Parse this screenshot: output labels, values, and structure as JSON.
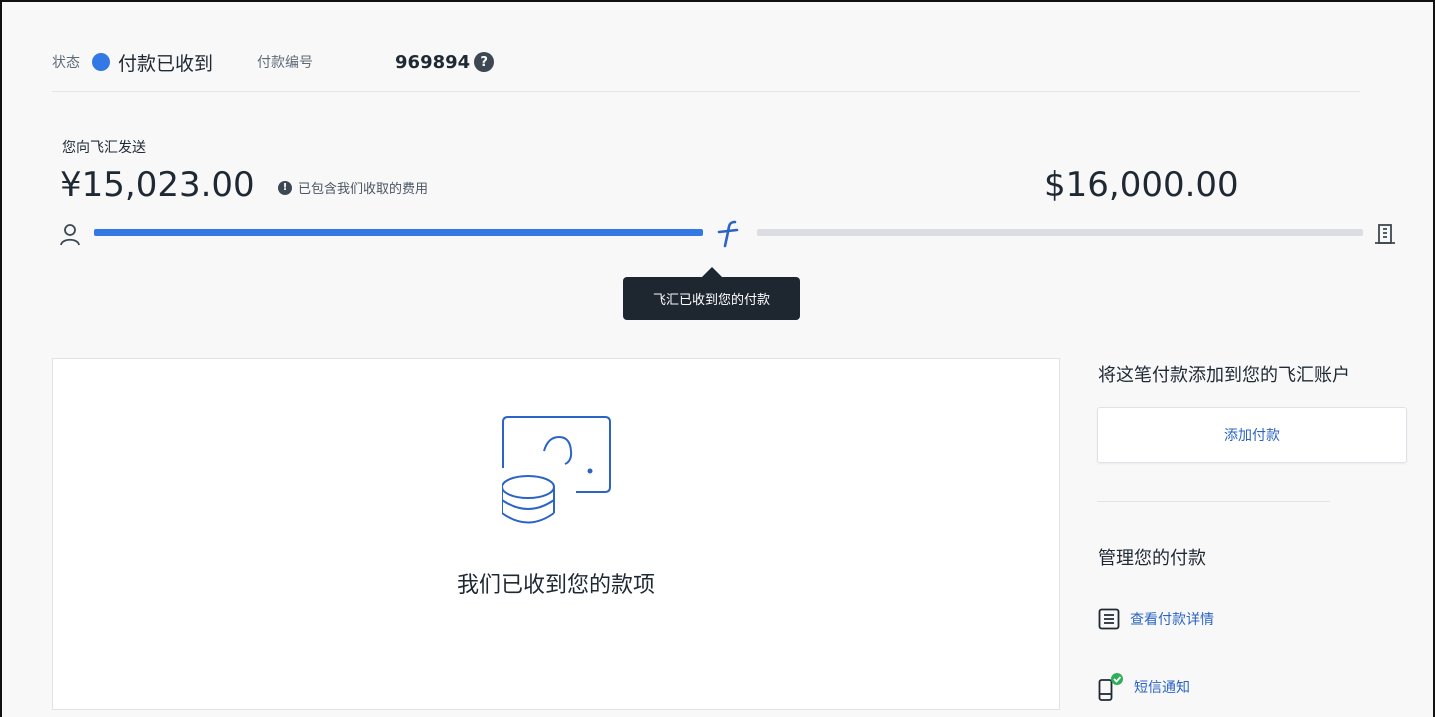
{
  "status": {
    "label": "状态",
    "value": "付款已收到",
    "payment_number_label": "付款编号",
    "payment_number": "969894",
    "help_icon": "question-circle-icon",
    "dot_color": "#3478e6"
  },
  "transfer": {
    "send_label": "您向飞汇发送",
    "amount_sent": "¥15,023.00",
    "fee_note": "已包含我们收取的费用",
    "info_icon": "info-circle-icon",
    "amount_received": "$16,000.00",
    "progress_fraction": 0.5,
    "progress_color": "#3478e6",
    "sender_icon": "person-icon",
    "brand_icon": "flywire-f-icon",
    "recipient_icon": "bank-building-icon"
  },
  "tooltip": {
    "text": "飞汇已收到您的付款"
  },
  "main_card": {
    "illustration_icon": "coins-wallet-icon",
    "message": "我们已收到您的款项"
  },
  "sidebar": {
    "add_title": "将这笔付款添加到您的飞汇账户",
    "add_button": "添加付款",
    "manage_title": "管理您的付款",
    "links": [
      {
        "label": "查看付款详情",
        "icon": "document-list-icon"
      },
      {
        "label": "短信通知",
        "icon": "phone-check-icon"
      }
    ],
    "link_color": "#2b64c4"
  }
}
